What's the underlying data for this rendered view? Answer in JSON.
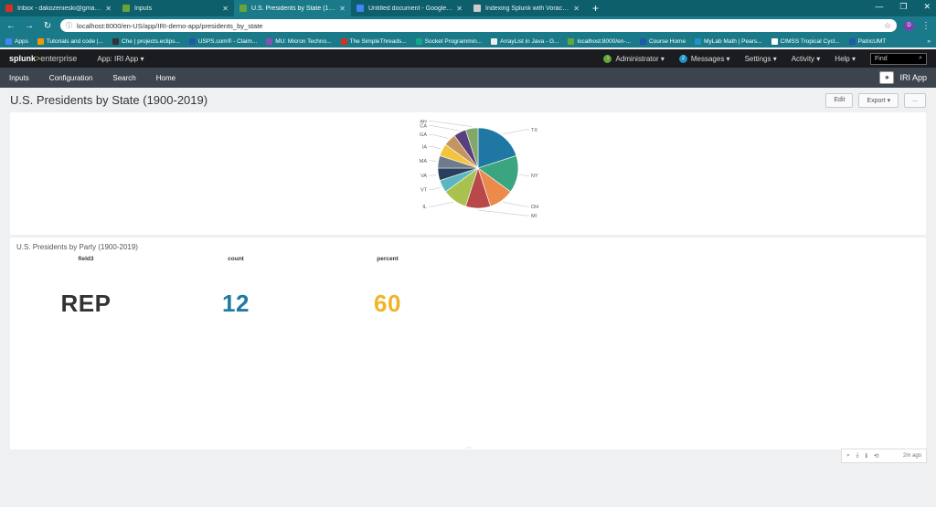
{
  "browser": {
    "tabs": [
      {
        "label": "Inbox - dakozenieski@gmail.com",
        "color": "#d93025",
        "active": false
      },
      {
        "label": "Inputs",
        "color": "#65a637",
        "active": false
      },
      {
        "label": "U.S. Presidents by State (1900-20",
        "color": "#65a637",
        "active": true
      },
      {
        "label": "Untitled document - Google Docs",
        "color": "#4285f4",
        "active": false
      },
      {
        "label": "Indexing Splunk with Voracity - I",
        "color": "#cccccc",
        "active": false
      }
    ],
    "url": "localhost:8000/en-US/app/IRI-demo-app/presidents_by_state",
    "profile_initial": "D",
    "bookmarks": [
      {
        "label": "Apps",
        "color": "#4285f4"
      },
      {
        "label": "Tutorials and code |...",
        "color": "#f29900"
      },
      {
        "label": "Che | projects.eclips...",
        "color": "#333333"
      },
      {
        "label": "USPS.com® - Claim...",
        "color": "#1e5aa8"
      },
      {
        "label": "MU: Micron Techno...",
        "color": "#8a4fb5"
      },
      {
        "label": "The SimpleThreads...",
        "color": "#d93025"
      },
      {
        "label": "Socket Programmin...",
        "color": "#17a589"
      },
      {
        "label": "ArrayList in Java - G...",
        "color": "#eeeeee"
      },
      {
        "label": "localhost:8000/en-...",
        "color": "#65a637"
      },
      {
        "label": "Course Home",
        "color": "#1e5aa8"
      },
      {
        "label": "MyLab Math | Pears...",
        "color": "#1e93c6"
      },
      {
        "label": "CIMSS Tropical Cycl...",
        "color": "#ffffff"
      },
      {
        "label": "PatricUMT",
        "color": "#1e5aa8"
      }
    ],
    "bookmarks_more": "»"
  },
  "splunk": {
    "logo_main": "splunk",
    "logo_gt": ">",
    "logo_ent": "enterprise",
    "app_menu": "App: IRI App ▾",
    "admin": "Administrator ▾",
    "admin_badge": "i",
    "messages_badge": "2",
    "messages": "Messages ▾",
    "settings": "Settings ▾",
    "activity": "Activity ▾",
    "help": "Help ▾",
    "find_placeholder": "Find"
  },
  "appnav": {
    "items": [
      "Inputs",
      "Configuration",
      "Search",
      "Home"
    ],
    "brand": "IRI App"
  },
  "dashboard": {
    "title": "U.S. Presidents by State (1900-2019)",
    "edit": "Edit",
    "export": "Export ▾",
    "more": "..."
  },
  "chart_data": {
    "type": "pie",
    "title": "",
    "slices": [
      {
        "label": "TX",
        "value": 4,
        "color": "#1f77a4"
      },
      {
        "label": "NY",
        "value": 3,
        "color": "#3aa57f"
      },
      {
        "label": "OH",
        "value": 2,
        "color": "#ec8a4c"
      },
      {
        "label": "MI",
        "value": 2,
        "color": "#b8484a"
      },
      {
        "label": "IL",
        "value": 2,
        "color": "#a9c24f"
      },
      {
        "label": "VT",
        "value": 1,
        "color": "#5ab7c1"
      },
      {
        "label": "VA",
        "value": 1,
        "color": "#2a3f5e"
      },
      {
        "label": "MA",
        "value": 1,
        "color": "#6f7b8a"
      },
      {
        "label": "IA",
        "value": 1,
        "color": "#f2c53d"
      },
      {
        "label": "GA",
        "value": 1,
        "color": "#c49562"
      },
      {
        "label": "CA",
        "value": 1,
        "color": "#5b3f7c"
      },
      {
        "label": "AR",
        "value": 1,
        "color": "#7fa86a"
      }
    ]
  },
  "panel2": {
    "title": "U.S. Presidents by Party (1900-2019)",
    "columns": [
      {
        "header": "field3",
        "value": "REP",
        "color": "#333333"
      },
      {
        "header": "count",
        "value": "12",
        "color": "#1e7aa0"
      },
      {
        "header": "percent",
        "value": "60",
        "color": "#f0b429"
      }
    ]
  },
  "panel_tools": {
    "ago": "2m ago"
  }
}
